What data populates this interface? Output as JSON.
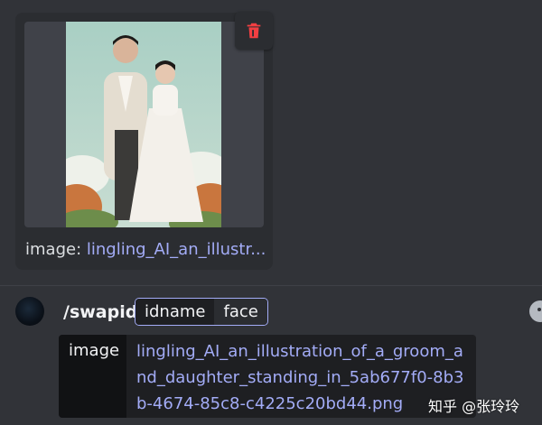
{
  "upload": {
    "label_key": "image:",
    "label_value": "lingling_AI_an_illustr..."
  },
  "command": {
    "name": "/swapid",
    "options": [
      "idname",
      "face"
    ]
  },
  "value": {
    "key": "image",
    "text": "lingling_AI_an_illustration_of_a_groom_and_daughter_standing_in_5ab677f0-8b3b-4674-85c8-c4225c20bd44.png"
  },
  "watermark": "知乎 @张玲玲",
  "colors": {
    "background": "#313338",
    "card": "#2b2d31",
    "link": "#a3acf7",
    "delete": "#f23f42"
  },
  "icons": {
    "delete": "trash-icon",
    "bot": "bot-avatar",
    "emoji": "emoji-icon"
  }
}
